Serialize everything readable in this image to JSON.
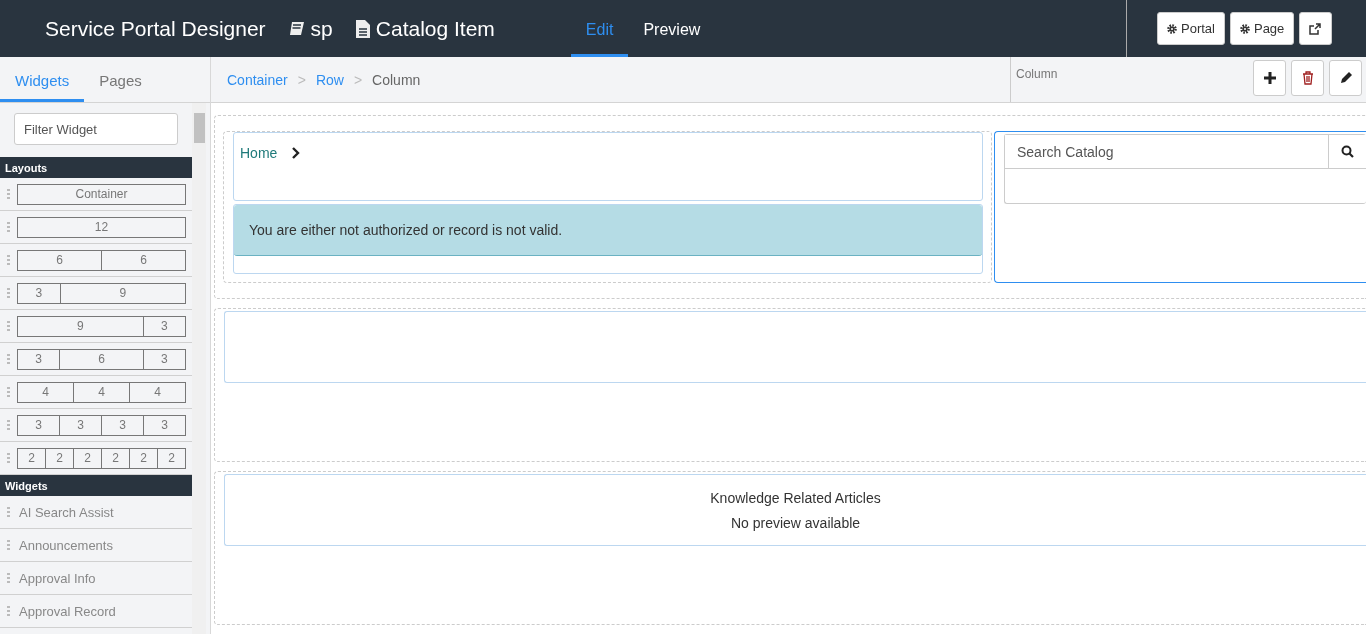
{
  "header": {
    "title": "Service Portal Designer",
    "portal": "sp",
    "page": "Catalog Item",
    "tabs": [
      {
        "label": "Edit",
        "selected": true
      },
      {
        "label": "Preview",
        "selected": false
      }
    ],
    "buttons": [
      {
        "kind": "portal",
        "label": "Portal"
      },
      {
        "kind": "page",
        "label": "Page"
      },
      {
        "kind": "external"
      }
    ]
  },
  "sidebar": {
    "tabs": [
      {
        "label": "Widgets",
        "selected": true
      },
      {
        "label": "Pages",
        "selected": false
      }
    ],
    "filter": {
      "placeholder": "Filter Widget"
    },
    "layouts_title": "Layouts",
    "layouts": [
      [
        "Container"
      ],
      [
        "12"
      ],
      [
        "6",
        "6"
      ],
      [
        "3",
        "9"
      ],
      [
        "9",
        "3"
      ],
      [
        "3",
        "6",
        "3"
      ],
      [
        "4",
        "4",
        "4"
      ],
      [
        "3",
        "3",
        "3",
        "3"
      ],
      [
        "2",
        "2",
        "2",
        "2",
        "2",
        "2"
      ]
    ],
    "widgets_title": "Widgets",
    "widgets": [
      "AI Search Assist",
      "Announcements",
      "Approval Info",
      "Approval Record"
    ]
  },
  "breadcrumb": {
    "separator": ">",
    "items": [
      {
        "label": "Container",
        "current": false
      },
      {
        "label": "Row",
        "current": false
      },
      {
        "label": "Column",
        "current": true
      }
    ]
  },
  "selection_panel": {
    "title": "Column",
    "buttons": [
      {
        "kind": "add"
      },
      {
        "kind": "delete"
      },
      {
        "kind": "edit"
      }
    ]
  },
  "canvas": {
    "home_link": "Home",
    "alert": "You are either not authorized or record is not valid.",
    "search": {
      "placeholder": "Search Catalog"
    },
    "widget_title": "Knowledge Related Articles",
    "widget_note": "No preview available"
  }
}
